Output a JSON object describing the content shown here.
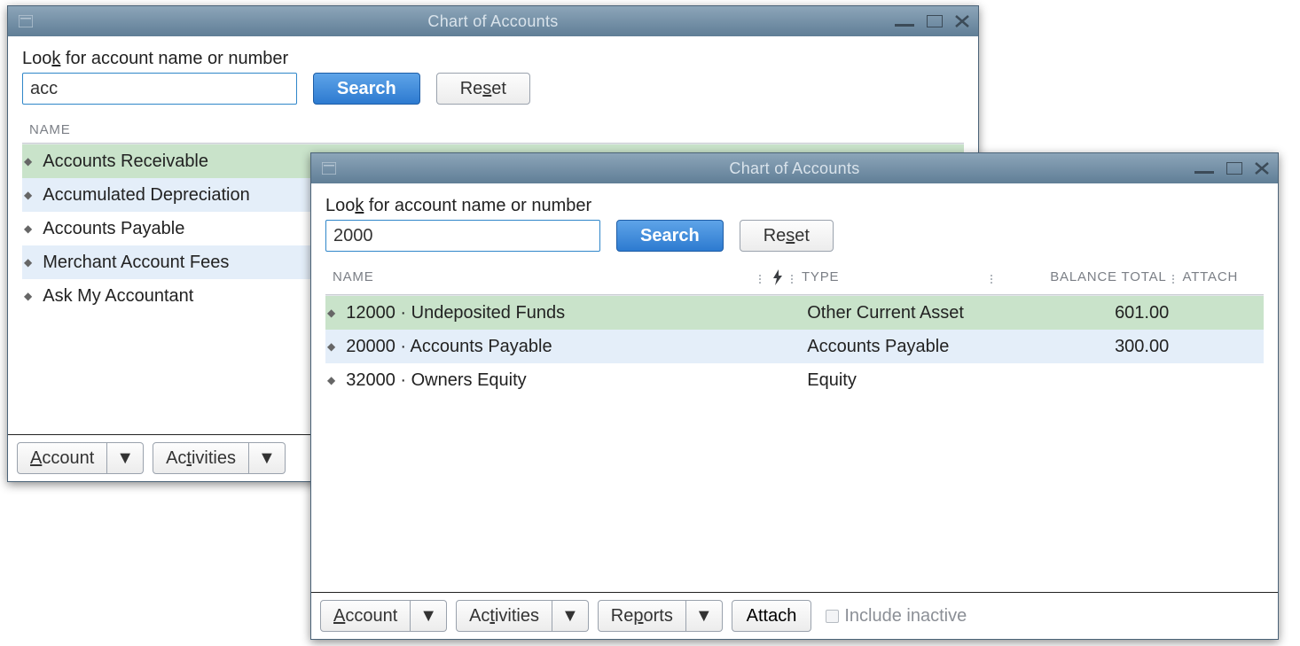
{
  "windows": {
    "w1": {
      "title": "Chart of Accounts",
      "search_label_prefix": "Loo",
      "search_label_ul": "k",
      "search_label_suffix": " for account name or number",
      "search_value": "acc",
      "search_button": "Search",
      "reset_prefix": "Re",
      "reset_ul": "s",
      "reset_suffix": "et",
      "col_name": "NAME",
      "rows": [
        {
          "name": "Accounts Receivable",
          "style": "row-green"
        },
        {
          "name": "Accumulated Depreciation",
          "style": "row-blue"
        },
        {
          "name": "Accounts Payable",
          "style": ""
        },
        {
          "name": "Merchant Account Fees",
          "style": "row-blue"
        },
        {
          "name": "Ask My Accountant",
          "style": ""
        }
      ],
      "footer": {
        "account_ul": "A",
        "account_rest": "ccount",
        "activities_prefix": "Ac",
        "activities_ul": "t",
        "activities_suffix": "ivities"
      }
    },
    "w2": {
      "title": "Chart of Accounts",
      "search_label_prefix": "Loo",
      "search_label_ul": "k",
      "search_label_suffix": " for account name or number",
      "search_value": "2000",
      "search_button": "Search",
      "reset_prefix": "Re",
      "reset_ul": "s",
      "reset_suffix": "et",
      "col_name": "NAME",
      "col_type": "TYPE",
      "col_balance": "BALANCE TOTAL",
      "col_attach": "ATTACH",
      "bolt_glyph": "⚡",
      "rows": [
        {
          "name": "12000 · Undeposited Funds",
          "type": "Other Current Asset",
          "balance": "601.00",
          "style": "row-green"
        },
        {
          "name": "20000 · Accounts Payable",
          "type": "Accounts Payable",
          "balance": "300.00",
          "style": "row-blue"
        },
        {
          "name": "32000 · Owners Equity",
          "type": "Equity",
          "balance": "",
          "style": ""
        }
      ],
      "footer": {
        "account_ul": "A",
        "account_rest": "ccount",
        "activities_prefix": "Ac",
        "activities_ul": "t",
        "activities_suffix": "ivities",
        "reports_prefix": "Re",
        "reports_ul": "p",
        "reports_suffix": "orts",
        "attach": "Attach",
        "include_prefix": "Include in",
        "include_ul": "a",
        "include_suffix": "ctive"
      }
    }
  }
}
